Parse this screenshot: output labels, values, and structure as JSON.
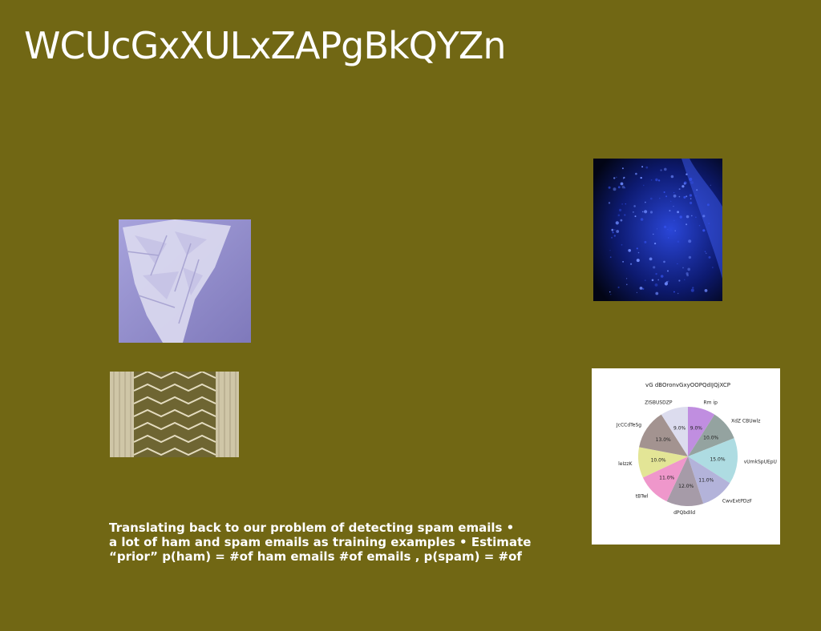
{
  "slide": {
    "title": "WCUcGxXULxZAPgBkQYZn",
    "background": "#716714",
    "body_lines": [
      "Translating back to our problem of detecting spam emails •",
      "a lot of ham and spam emails as training examples • Estimate",
      "“prior” p(ham) = #of ham emails #of emails , p(spam) = #of"
    ]
  },
  "images": [
    {
      "name": "crumpled-lavender-paper-photo",
      "dominant_color": "#8e88c8"
    },
    {
      "name": "building-facade-photo",
      "dominant_color": "#b9ae8d"
    },
    {
      "name": "blue-particles-photo",
      "dominant_color": "#1f3dd0"
    }
  ],
  "chart_data": {
    "type": "pie",
    "title": "vG dBOronvGxyOOPQdIJQjXCP",
    "slices": [
      {
        "label": "Rm ip",
        "value": 9.0,
        "display": "9.0%",
        "color": "#c08ee0"
      },
      {
        "label": "XdZ CBUwlz",
        "value": 10.0,
        "display": "10.0%",
        "color": "#94a3a0"
      },
      {
        "label": "vUmkSpUEpU",
        "value": 15.0,
        "display": "15.0%",
        "color": "#aedce2"
      },
      {
        "label": "CwvExtPDzF",
        "value": 11.0,
        "display": "11.0%",
        "color": "#b3b3da"
      },
      {
        "label": "dPQbdIld",
        "value": 12.0,
        "display": "12.0%",
        "color": "#a69ba8"
      },
      {
        "label": "tBTwl",
        "value": 11.0,
        "display": "11.0%",
        "color": "#ef97cb"
      },
      {
        "label": "leIzzK",
        "value": 10.0,
        "display": "10.0%",
        "color": "#e3e596"
      },
      {
        "label": "JcCCdTeSg",
        "value": 13.0,
        "display": "13.0%",
        "color": "#a39390"
      },
      {
        "label": "ZISBUSDZP",
        "value": 9.0,
        "display": "9.0%",
        "color": "#dcdcee"
      }
    ]
  }
}
